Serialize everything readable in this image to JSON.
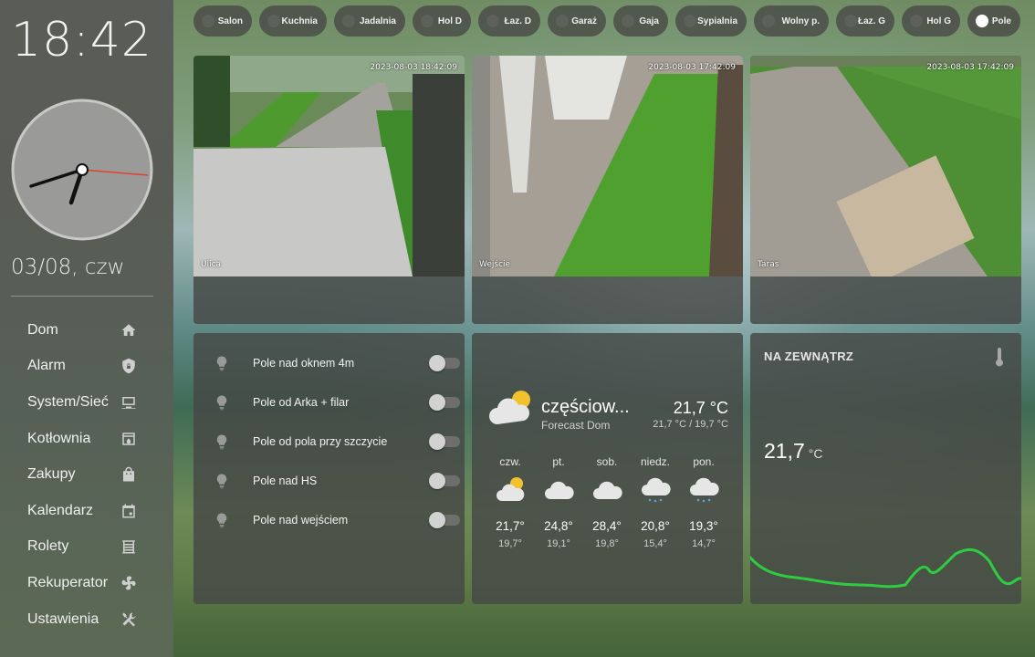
{
  "sidebar": {
    "time": "18:42",
    "date": "03/08, czw",
    "nav": [
      {
        "label": "Dom",
        "icon": "home-icon"
      },
      {
        "label": "Alarm",
        "icon": "shield-lock-icon"
      },
      {
        "label": "System/Sieć",
        "icon": "monitor-icon"
      },
      {
        "label": "Kotłownia",
        "icon": "boiler-icon"
      },
      {
        "label": "Zakupy",
        "icon": "shopping-bag-icon"
      },
      {
        "label": "Kalendarz",
        "icon": "calendar-icon"
      },
      {
        "label": "Rolety",
        "icon": "blinds-icon"
      },
      {
        "label": "Rekuperator",
        "icon": "fan-icon"
      },
      {
        "label": "Ustawienia",
        "icon": "tools-icon"
      }
    ]
  },
  "rooms": [
    {
      "label": "Salon",
      "on": false
    },
    {
      "label": "Kuchnia",
      "on": false
    },
    {
      "label": "Jadalnia",
      "on": false
    },
    {
      "label": "Hol D",
      "on": false
    },
    {
      "label": "Łaz. D",
      "on": false
    },
    {
      "label": "Garaż",
      "on": false
    },
    {
      "label": "Gaja",
      "on": false
    },
    {
      "label": "Sypialnia",
      "on": false
    },
    {
      "label": "Wolny p.",
      "on": false
    },
    {
      "label": "Łaz. G",
      "on": false
    },
    {
      "label": "Hol G",
      "on": false
    },
    {
      "label": "Pole",
      "on": true
    }
  ],
  "cameras": [
    {
      "name": "Ulica",
      "timestamp": "2023-08-03 18:42:09"
    },
    {
      "name": "Wejście",
      "timestamp": "2023-08-03 17:42:09"
    },
    {
      "name": "Taras",
      "timestamp": "2023-08-03 17:42:09"
    }
  ],
  "switches": [
    {
      "label": "Pole nad oknem 4m",
      "on": false
    },
    {
      "label": "Pole od Arka + filar",
      "on": false
    },
    {
      "label": "Pole od pola przy szczycie",
      "on": false
    },
    {
      "label": "Pole nad HS",
      "on": false
    },
    {
      "label": "Pole nad wejściem",
      "on": false
    }
  ],
  "weather": {
    "condition": "częściow...",
    "source": "Forecast Dom",
    "temperature": "21,7 °C",
    "range": "21,7 °C / 19,7 °C",
    "forecast": [
      {
        "day": "czw.",
        "hi": "21,7°",
        "lo": "19,7°",
        "icon": "partly-cloudy-icon"
      },
      {
        "day": "pt.",
        "hi": "24,8°",
        "lo": "19,1°",
        "icon": "cloudy-icon"
      },
      {
        "day": "sob.",
        "hi": "28,4°",
        "lo": "19,8°",
        "icon": "cloudy-icon"
      },
      {
        "day": "niedz.",
        "hi": "20,8°",
        "lo": "15,4°",
        "icon": "rainy-icon"
      },
      {
        "day": "pon.",
        "hi": "19,3°",
        "lo": "14,7°",
        "icon": "rainy-icon"
      }
    ]
  },
  "outside": {
    "title": "NA ZEWNĄTRZ",
    "value": "21,7",
    "unit": "°C",
    "icon": "thermometer-icon",
    "line_color": "#2ecc40"
  }
}
